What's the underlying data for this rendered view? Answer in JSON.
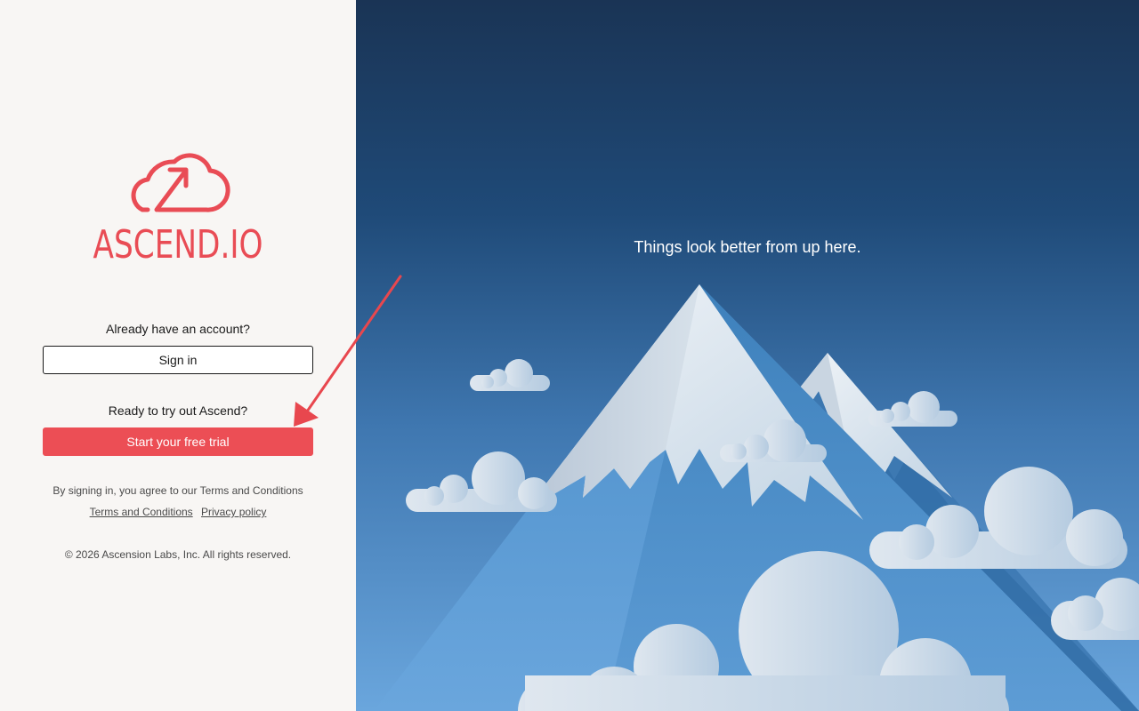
{
  "brand": {
    "name": "ASCEND.IO",
    "logo_icon": "cloud-upload-arrow-icon",
    "color": "#e94c55"
  },
  "signin_section": {
    "prompt": "Already have an account?",
    "button_label": "Sign in"
  },
  "trial_section": {
    "prompt": "Ready to try out Ascend?",
    "button_label": "Start your free trial",
    "button_color": "#ec4e55"
  },
  "legal": {
    "agreement_text": "By signing in, you agree to our Terms and Conditions",
    "terms_link": "Terms and Conditions",
    "privacy_link": "Privacy policy",
    "copyright": "© 2026 Ascension Labs, Inc. All rights reserved."
  },
  "hero": {
    "tagline": "Things look better from up here.",
    "illustration": "mountain-clouds-illustration"
  },
  "annotation": {
    "arrow_color": "#e8474e",
    "points_to": "trial-button"
  }
}
